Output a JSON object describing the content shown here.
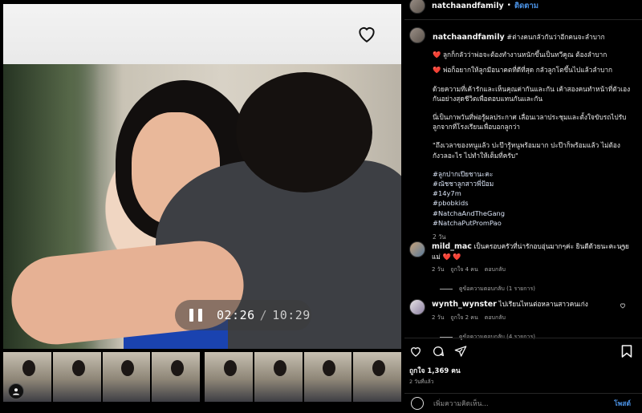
{
  "video": {
    "time_current": "02:26",
    "time_separator": "/",
    "time_total": "10:29"
  },
  "post": {
    "username": "natchaandfamily",
    "dot": "•",
    "follow_label": "ติดตาม",
    "caption_lines": [
      "#ต่างคนกลัวกันว่าอีกคนจะลำบาก",
      "❤️ ลูกก็กลัวว่าพ่อจะต้องทำงานหนักขึ้นเป็นทวีคูณ ต้องลำบาก",
      "❤️ พ่อก็อยากให้ลูกมีอนาคตที่ดีที่สุด กลัวลูกโตขึ้นไปแล้วลำบาก",
      "ด้วยความที่เค้ารักและเห็นคุณค่ากันและกัน เค้าสองคนทำหน้าที่ตัวเองกันอย่างสุดชีวิตเพื่อตอบแทนกันและกัน",
      "นี่เป็นภาพวันที่พ่อรู้ผลประกาศ เลื่อนเวลาประชุมและตั้งใจขับรถไปรับลูกจากที่โรงเรียนเพื่อบอกลูกว่า",
      "\"ถึงเวลาของหนูแล้ว ปะป๊ารู้หนูพร้อมมาก ปะป๊าก็พร้อมแล้ว ไม่ต้องกังวลอะไร ไปทำให้เต็มที่ครับ\""
    ],
    "hashtags": [
      "#ลูกปากเปียชานะคะ",
      "#ณัชชาลูกสาวพี่ป้อม",
      "#14y7m",
      "#pbobkids",
      "#NatchaAndTheGang",
      "#NatchaPutPromPao"
    ],
    "caption_age": "2 วัน"
  },
  "comments": [
    {
      "user": "mild_mac",
      "text": "เป็นครอบครัวที่น่ารักอบอุ่นมากๆค่ะ ยินดีด้วยนะคะนายแม่ ❤️ ❤️",
      "age": "2 วัน",
      "likes": "ถูกใจ 4 คน",
      "reply_label": "ตอบกลับ",
      "view_replies": "ดูข้อความตอบกลับ (1 รายการ)"
    },
    {
      "user": "wynth_wynster",
      "text": "ไปเรียนไหนต่อหลานสาวคนเก่ง",
      "age": "2 วัน",
      "likes": "ถูกใจ 2 คน",
      "reply_label": "ตอบกลับ",
      "view_replies": "ดูข้อความตอบกลับ (4 รายการ)"
    }
  ],
  "footer": {
    "likes": "ถูกใจ 1,369 คน",
    "ago": "2 วันที่แล้ว",
    "comment_placeholder": "เพิ่มความคิดเห็น...",
    "post_label": "โพสต์"
  },
  "colors": {
    "accent": "#4a90e2",
    "background": "#000000"
  }
}
